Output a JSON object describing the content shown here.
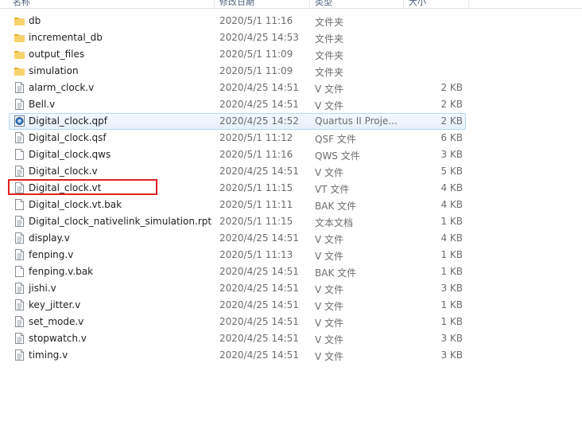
{
  "header": {
    "name": "名称",
    "date": "修改日期",
    "type": "类型",
    "size": "大小"
  },
  "files": [
    {
      "name": "db",
      "date": "2020/5/1 11:16",
      "type": "文件夹",
      "size": "",
      "icon": "folder-icon"
    },
    {
      "name": "incremental_db",
      "date": "2020/4/25 14:53",
      "type": "文件夹",
      "size": "",
      "icon": "folder-icon"
    },
    {
      "name": "output_files",
      "date": "2020/5/1 11:09",
      "type": "文件夹",
      "size": "",
      "icon": "folder-icon"
    },
    {
      "name": "simulation",
      "date": "2020/5/1 11:09",
      "type": "文件夹",
      "size": "",
      "icon": "folder-icon"
    },
    {
      "name": "alarm_clock.v",
      "date": "2020/4/25 14:51",
      "type": "V 文件",
      "size": "2 KB",
      "icon": "text-file-icon"
    },
    {
      "name": "Bell.v",
      "date": "2020/4/25 14:51",
      "type": "V 文件",
      "size": "2 KB",
      "icon": "text-file-icon"
    },
    {
      "name": "Digital_clock.qpf",
      "date": "2020/4/25 14:52",
      "type": "Quartus II Proje...",
      "size": "2 KB",
      "icon": "quartus-project-icon"
    },
    {
      "name": "Digital_clock.qsf",
      "date": "2020/5/1 11:12",
      "type": "QSF 文件",
      "size": "6 KB",
      "icon": "text-file-icon"
    },
    {
      "name": "Digital_clock.qws",
      "date": "2020/5/1 11:16",
      "type": "QWS 文件",
      "size": "3 KB",
      "icon": "blank-file-icon"
    },
    {
      "name": "Digital_clock.v",
      "date": "2020/4/25 14:51",
      "type": "V 文件",
      "size": "5 KB",
      "icon": "text-file-icon"
    },
    {
      "name": "Digital_clock.vt",
      "date": "2020/5/1 11:15",
      "type": "VT 文件",
      "size": "4 KB",
      "icon": "text-file-icon"
    },
    {
      "name": "Digital_clock.vt.bak",
      "date": "2020/5/1 11:11",
      "type": "BAK 文件",
      "size": "4 KB",
      "icon": "blank-file-icon"
    },
    {
      "name": "Digital_clock_nativelink_simulation.rpt",
      "date": "2020/5/1 11:15",
      "type": "文本文档",
      "size": "1 KB",
      "icon": "text-file-icon"
    },
    {
      "name": "display.v",
      "date": "2020/4/25 14:51",
      "type": "V 文件",
      "size": "4 KB",
      "icon": "text-file-icon"
    },
    {
      "name": "fenping.v",
      "date": "2020/5/1 11:13",
      "type": "V 文件",
      "size": "1 KB",
      "icon": "text-file-icon"
    },
    {
      "name": "fenping.v.bak",
      "date": "2020/4/25 14:51",
      "type": "BAK 文件",
      "size": "1 KB",
      "icon": "blank-file-icon"
    },
    {
      "name": "jishi.v",
      "date": "2020/4/25 14:51",
      "type": "V 文件",
      "size": "3 KB",
      "icon": "text-file-icon"
    },
    {
      "name": "key_jitter.v",
      "date": "2020/4/25 14:51",
      "type": "V 文件",
      "size": "1 KB",
      "icon": "text-file-icon"
    },
    {
      "name": "set_mode.v",
      "date": "2020/4/25 14:51",
      "type": "V 文件",
      "size": "1 KB",
      "icon": "text-file-icon"
    },
    {
      "name": "stopwatch.v",
      "date": "2020/4/25 14:51",
      "type": "V 文件",
      "size": "3 KB",
      "icon": "text-file-icon"
    },
    {
      "name": "timing.v",
      "date": "2020/4/25 14:51",
      "type": "V 文件",
      "size": "3 KB",
      "icon": "text-file-icon"
    }
  ],
  "selected_file": "Digital_clock.qpf",
  "annotated_file": "Digital_clock.vt",
  "colors": {
    "folder": "#f0c24a",
    "selection_border": "#b8d6fb",
    "annotation_border": "#e02020"
  }
}
